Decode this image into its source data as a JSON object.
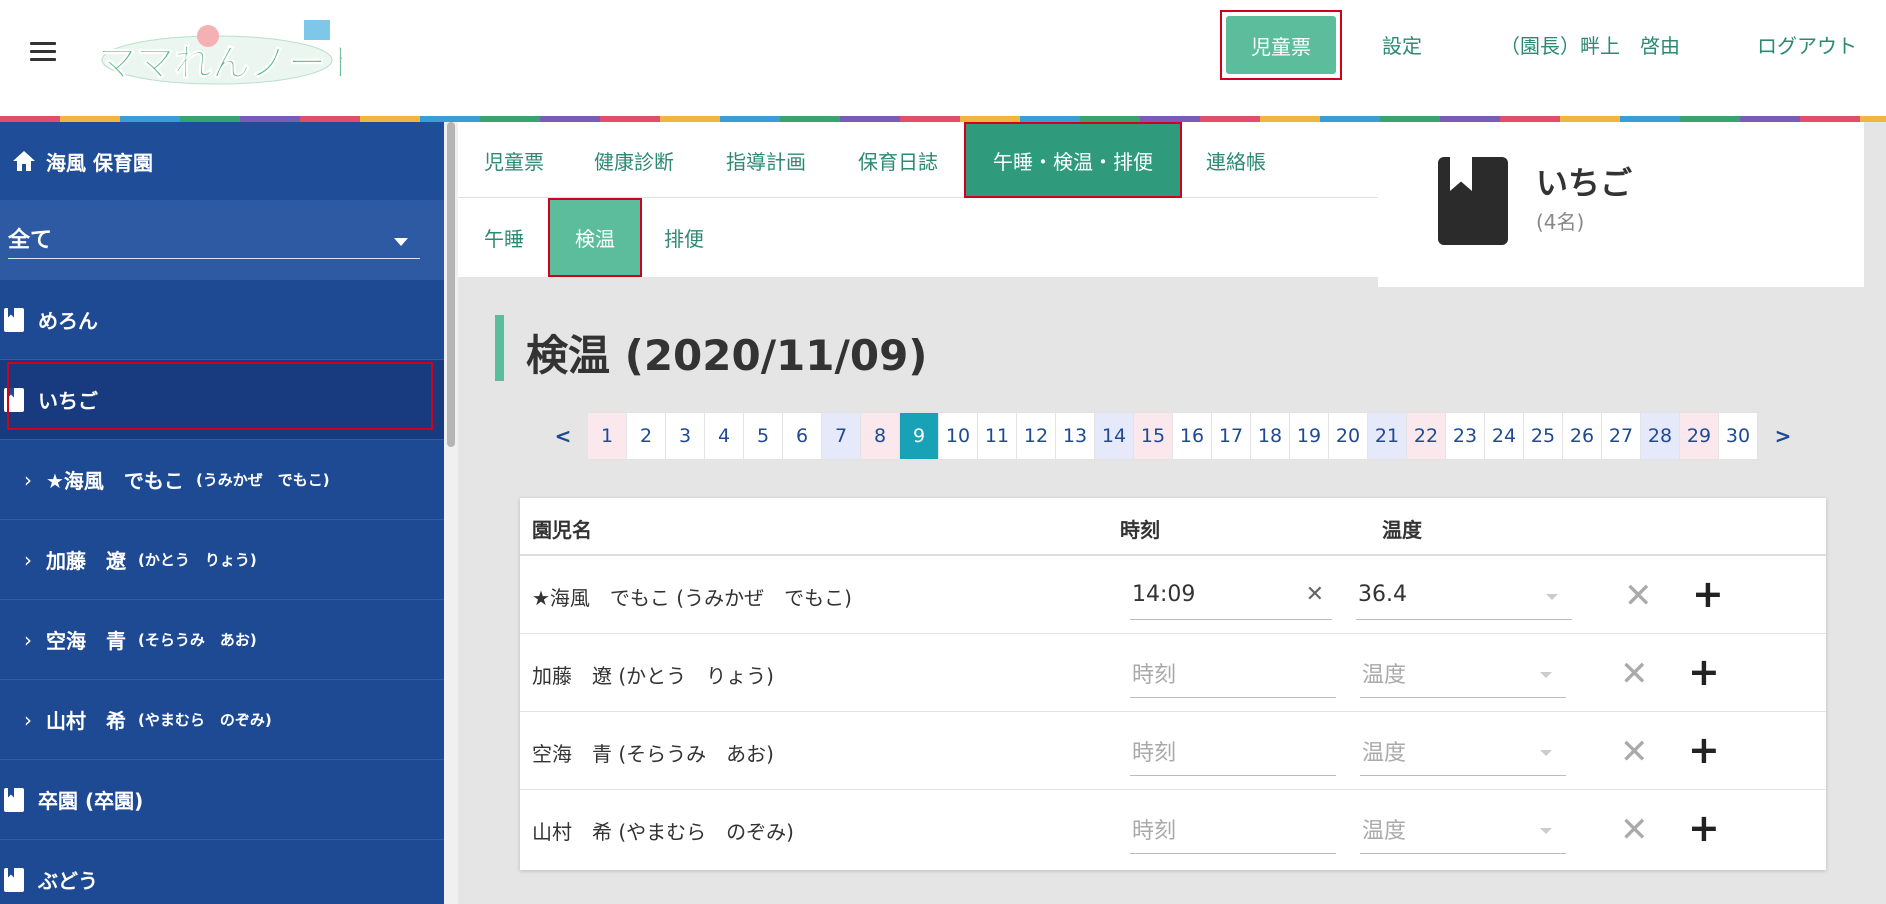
{
  "header": {
    "logo_text": "ママれんノート",
    "nav_active": "児童票",
    "nav_settings": "設定",
    "nav_user": "（園長）畔上　啓由",
    "nav_logout": "ログアウト"
  },
  "sidebar": {
    "home": "海風 保育園",
    "select_value": "全て",
    "classes": [
      {
        "label": "めろん"
      },
      {
        "label": "いちご"
      },
      {
        "label": "卒園 (卒園)"
      },
      {
        "label": "ぶどう"
      }
    ],
    "children": [
      {
        "name": "★海風　でもこ",
        "kana": "(うみかぜ　でもこ)"
      },
      {
        "name": "加藤　遼",
        "kana": "(かとう　りょう)"
      },
      {
        "name": "空海　青",
        "kana": "(そらうみ　あお)"
      },
      {
        "name": "山村　希",
        "kana": "(やまむら　のぞみ)"
      }
    ]
  },
  "tabs": {
    "primary": [
      "児童票",
      "健康診断",
      "指導計画",
      "保育日誌",
      "午睡・検温・排便",
      "連絡帳"
    ],
    "secondary": [
      "午睡",
      "検温",
      "排便"
    ]
  },
  "class_card": {
    "name": "いちご",
    "count": "(4名)"
  },
  "page_title": "検温 (2020/11/09)",
  "pager": {
    "prev": "<",
    "next": ">",
    "selected": 9,
    "days": [
      "1",
      "2",
      "3",
      "4",
      "5",
      "6",
      "7",
      "8",
      "9",
      "10",
      "11",
      "12",
      "13",
      "14",
      "15",
      "16",
      "17",
      "18",
      "19",
      "20",
      "21",
      "22",
      "23",
      "24",
      "25",
      "26",
      "27",
      "28",
      "29",
      "30"
    ]
  },
  "table": {
    "headers": {
      "name": "園児名",
      "time": "時刻",
      "temp": "温度"
    },
    "rows": [
      {
        "name": "★海風　でもこ (うみかぜ　でもこ)",
        "time": "14:09",
        "temp": "36.4"
      },
      {
        "name": "加藤　遼 (かとう　りょう)",
        "time": "",
        "temp": ""
      },
      {
        "name": "空海　青 (そらうみ　あお)",
        "time": "",
        "temp": ""
      },
      {
        "name": "山村　希 (やまむら　のぞみ)",
        "time": "",
        "temp": ""
      }
    ],
    "time_placeholder": "時刻",
    "temp_placeholder": "温度"
  }
}
